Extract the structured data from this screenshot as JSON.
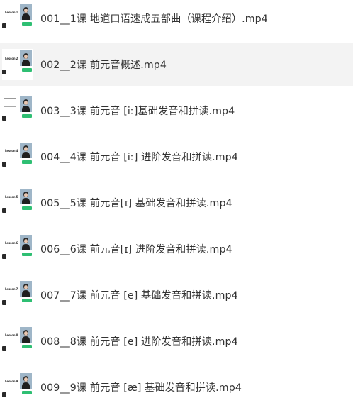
{
  "files": [
    {
      "name": "001__1课 地道口语速成五部曲（课程介绍）.mp4",
      "thumbnail_icon": "video-thumbnail-lesson-intro",
      "thumb_tag": "Lesson 1",
      "selected": false
    },
    {
      "name": "002__2课 前元音概述.mp4",
      "thumbnail_icon": "video-thumbnail-lesson",
      "thumb_tag": "Lesson 2",
      "selected": true
    },
    {
      "name": "003__3课 前元音 [iː]基础发音和拼读.mp4",
      "thumbnail_icon": "video-thumbnail-lesson-notes",
      "thumb_tag": "",
      "selected": false
    },
    {
      "name": "004__4课 前元音 [iː] 进阶发音和拼读.mp4",
      "thumbnail_icon": "video-thumbnail-lesson",
      "thumb_tag": "Lesson 4",
      "selected": false
    },
    {
      "name": "005__5课 前元音[ɪ] 基础发音和拼读.mp4",
      "thumbnail_icon": "video-thumbnail-lesson",
      "thumb_tag": "Lesson 5",
      "selected": false
    },
    {
      "name": "006__6课 前元音[ɪ] 进阶发音和拼读.mp4",
      "thumbnail_icon": "video-thumbnail-lesson",
      "thumb_tag": "Lesson 6",
      "selected": false
    },
    {
      "name": "007__7课 前元音 [e] 基础发音和拼读.mp4",
      "thumbnail_icon": "video-thumbnail-lesson",
      "thumb_tag": "Lesson 7",
      "selected": false
    },
    {
      "name": "008__8课 前元音 [e] 进阶发音和拼读.mp4",
      "thumbnail_icon": "video-thumbnail-lesson",
      "thumb_tag": "Lesson 8",
      "selected": false
    },
    {
      "name": "009__9课 前元音 [æ] 基础发音和拼读.mp4",
      "thumbnail_icon": "video-thumbnail-lesson",
      "thumb_tag": "Lesson 9",
      "selected": false
    }
  ],
  "colors": {
    "selected_row_bg": "#f3f3f3",
    "text": "#333333",
    "thumb_accent_green": "#2fbf73"
  }
}
